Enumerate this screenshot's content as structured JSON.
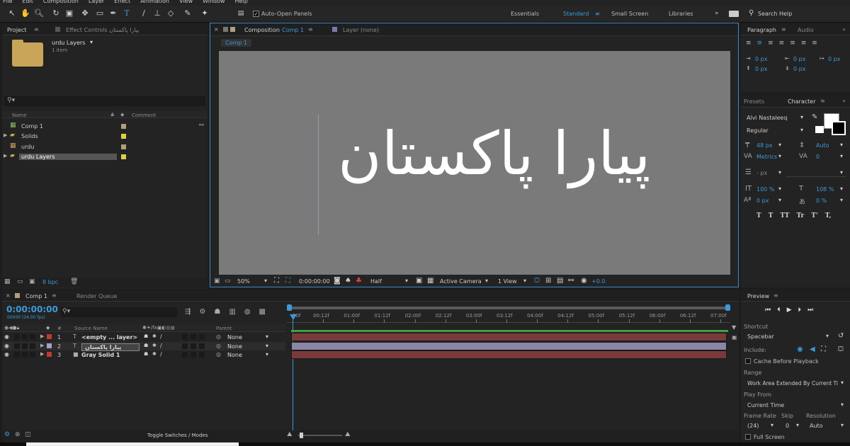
{
  "menu": [
    "File",
    "Edit",
    "Composition",
    "Layer",
    "Effect",
    "Animation",
    "View",
    "Window",
    "Help"
  ],
  "toolbar": {
    "auto_open": "Auto-Open Panels",
    "workspaces": [
      "Essentials",
      "Standard",
      "Small Screen",
      "Libraries"
    ],
    "search": "Search Help"
  },
  "project": {
    "tabs": {
      "project": "Project",
      "effect_controls": "Effect Controls پیارا پاکستان"
    },
    "folder_name": "urdu Layers",
    "folder_count": "1 item",
    "cols": {
      "name": "Name",
      "comment": "Comment"
    },
    "items": [
      {
        "name": "Comp 1",
        "color": "#b0a07a"
      },
      {
        "name": "Solids",
        "color": "#e0d040"
      },
      {
        "name": "urdu",
        "color": "#b0a07a"
      },
      {
        "name": "urdu Layers",
        "color": "#e0d040"
      }
    ],
    "bpc": "8 bpc"
  },
  "composition": {
    "tab": "Composition",
    "tab_comp": "Comp 1",
    "layer_tab": "Layer (none)",
    "crumb": "Comp 1",
    "canvas_text": "پیارا پاکستان",
    "zoom": "50%",
    "timecode": "0:00:00:00",
    "resolution": "Half",
    "camera": "Active Camera",
    "views": "1 View",
    "exposure": "+0.0"
  },
  "paragraph": {
    "tabs": [
      "Paragraph",
      "Audio"
    ],
    "px": [
      "0 px",
      "0 px",
      "0 px",
      "0 px",
      "0 px"
    ]
  },
  "character": {
    "tabs": [
      "Presets",
      "Character"
    ],
    "font": "Alvi Nastaleeq",
    "style": "Regular",
    "size": "48 px",
    "leading": "Auto",
    "kerning": "Metrics",
    "tracking": "0",
    "stroke": "- px",
    "vscale": "100 %",
    "hscale": "108 %",
    "baseline": "0 px",
    "tsume": "0 %",
    "styles": [
      "T",
      "T",
      "TT",
      "Tr",
      "T'",
      "T,"
    ]
  },
  "timeline": {
    "tab": "Comp 1",
    "render_tab": "Render Queue",
    "timecode": "0:00:00:00",
    "fps": "00000 (24.00 fps)",
    "cols": {
      "num": "#",
      "source": "Source Name",
      "parent": "Parent"
    },
    "ruler": [
      "00f",
      "00:12f",
      "01:00f",
      "01:12f",
      "02:00f",
      "02:12f",
      "03:00f",
      "03:12f",
      "04:00f",
      "04:12f",
      "05:00f",
      "05:12f",
      "06:00f",
      "06:12f",
      "07:00f"
    ],
    "layers": [
      {
        "num": "1",
        "name": "<empty ... layer>",
        "color": "#c03838",
        "parent": "None",
        "bar": "#7a3a3a"
      },
      {
        "num": "2",
        "name": "پیارا پاکستان",
        "color": "#a8a0c8",
        "parent": "None",
        "bar": "#8a86a8"
      },
      {
        "num": "3",
        "name": "Gray Solid 1",
        "color": "#c03838",
        "parent": "None",
        "bar": "#7a3a3a"
      }
    ],
    "toggle": "Toggle Switches / Modes"
  },
  "preview": {
    "title": "Preview",
    "shortcut_label": "Shortcut",
    "shortcut": "Spacebar",
    "include": "Include:",
    "cache": "Cache Before Playback",
    "range_label": "Range",
    "range": "Work Area Extended By Current Ti",
    "playfrom_label": "Play From",
    "playfrom": "Current Time",
    "framerate_label": "Frame Rate",
    "skip_label": "Skip",
    "resolution_label": "Resolution",
    "framerate": "(24)",
    "skip": "0",
    "resolution": "Auto",
    "fullscreen": "Full Screen"
  }
}
